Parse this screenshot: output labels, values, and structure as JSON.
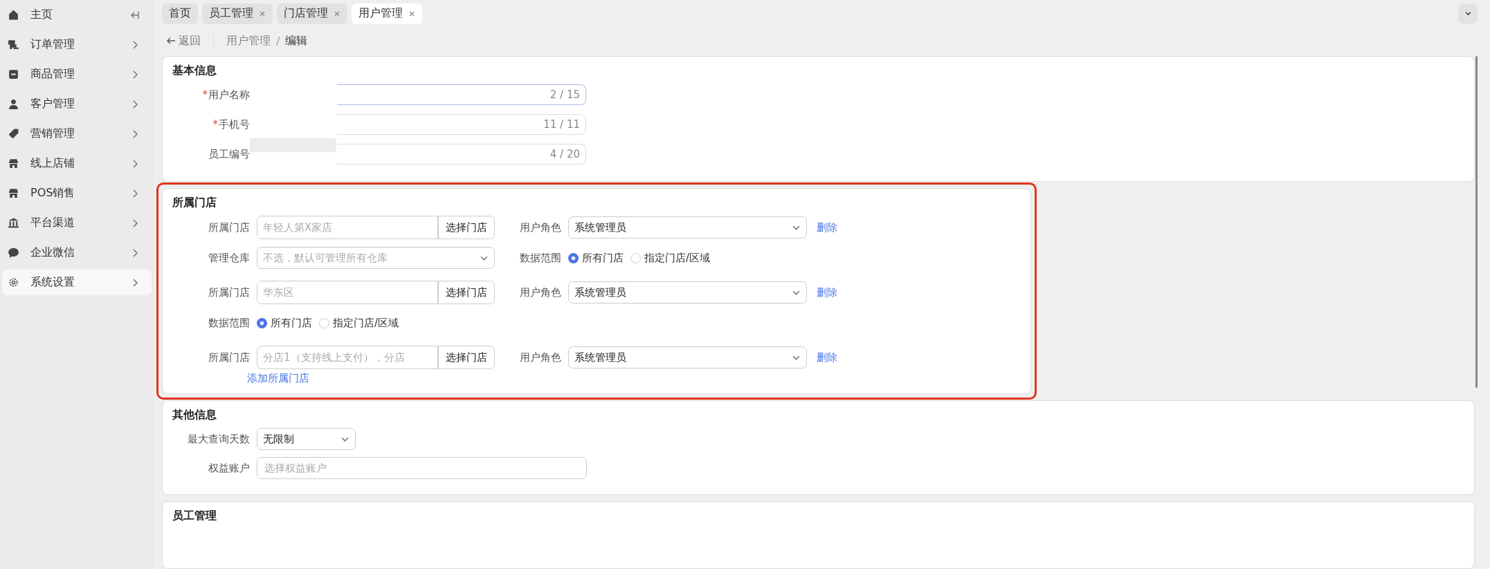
{
  "sidebar": {
    "items": [
      {
        "label": "主页",
        "selected": false
      },
      {
        "label": "订单管理",
        "selected": false
      },
      {
        "label": "商品管理",
        "selected": false
      },
      {
        "label": "客户管理",
        "selected": false
      },
      {
        "label": "营销管理",
        "selected": false
      },
      {
        "label": "线上店铺",
        "selected": false
      },
      {
        "label": "POS销售",
        "selected": false
      },
      {
        "label": "平台渠道",
        "selected": false
      },
      {
        "label": "企业微信",
        "selected": false
      },
      {
        "label": "系统设置",
        "selected": true
      }
    ]
  },
  "tabs": [
    {
      "label": "首页",
      "selected": false,
      "closable": false
    },
    {
      "label": "员工管理",
      "selected": false,
      "closable": true
    },
    {
      "label": "门店管理",
      "selected": false,
      "closable": true
    },
    {
      "label": "用户管理",
      "selected": true,
      "closable": true
    }
  ],
  "breadcrumb": {
    "back": "返回",
    "separator": "/",
    "items": [
      "用户管理",
      "编辑"
    ]
  },
  "basic_info": {
    "title": "基本信息",
    "fields": [
      {
        "label": "用户名称",
        "required_mark": "*",
        "counter": "2 / 15",
        "focused": true
      },
      {
        "label": "手机号",
        "required_mark": "*",
        "counter": "11 / 11",
        "focused": false
      },
      {
        "label": "员工编号",
        "counter": "4 / 20",
        "focused": false
      }
    ]
  },
  "store_section": {
    "title": "所属门店",
    "highlighted": true,
    "groups": [
      {
        "rows": [
          {
            "left": {
              "kind": "store-picker",
              "label": "所属门店",
              "placeholder": "年轻人第X家店",
              "button": "选择门店"
            },
            "right": {
              "kind": "select",
              "label": "用户角色",
              "value": "系统管理员",
              "link": "删除"
            }
          },
          {
            "left": {
              "kind": "dropdown",
              "label": "管理仓库",
              "placeholder": "不选，默认可管理所有仓库"
            },
            "right": {
              "kind": "radio",
              "label": "数据范围",
              "options": [
                {
                  "label": "所有门店",
                  "selected": true
                },
                {
                  "label": "指定门店/区域",
                  "selected": false
                }
              ]
            }
          }
        ]
      },
      {
        "rows": [
          {
            "left": {
              "kind": "store-picker",
              "label": "所属门店",
              "placeholder": "华东区",
              "button": "选择门店"
            },
            "right": {
              "kind": "select",
              "label": "用户角色",
              "value": "系统管理员",
              "link": "删除"
            }
          },
          {
            "left": {
              "kind": "radio",
              "label": "数据范围",
              "options": [
                {
                  "label": "所有门店",
                  "selected": true
                },
                {
                  "label": "指定门店/区域",
                  "selected": false
                }
              ]
            }
          }
        ]
      },
      {
        "rows": [
          {
            "left": {
              "kind": "store-picker",
              "label": "所属门店",
              "placeholder": "分店1（支持线上支付），分店",
              "button": "选择门店"
            },
            "right": {
              "kind": "select",
              "label": "用户角色",
              "value": "系统管理员",
              "link": "删除"
            }
          }
        ]
      }
    ],
    "add_link": "添加所属门店"
  },
  "other_info": {
    "title": "其他信息",
    "max_days": {
      "label": "最大查询天数",
      "value": "无限制"
    },
    "account": {
      "label": "权益账户",
      "placeholder": "选择权益账户"
    }
  },
  "staff_section": {
    "title": "员工管理"
  }
}
